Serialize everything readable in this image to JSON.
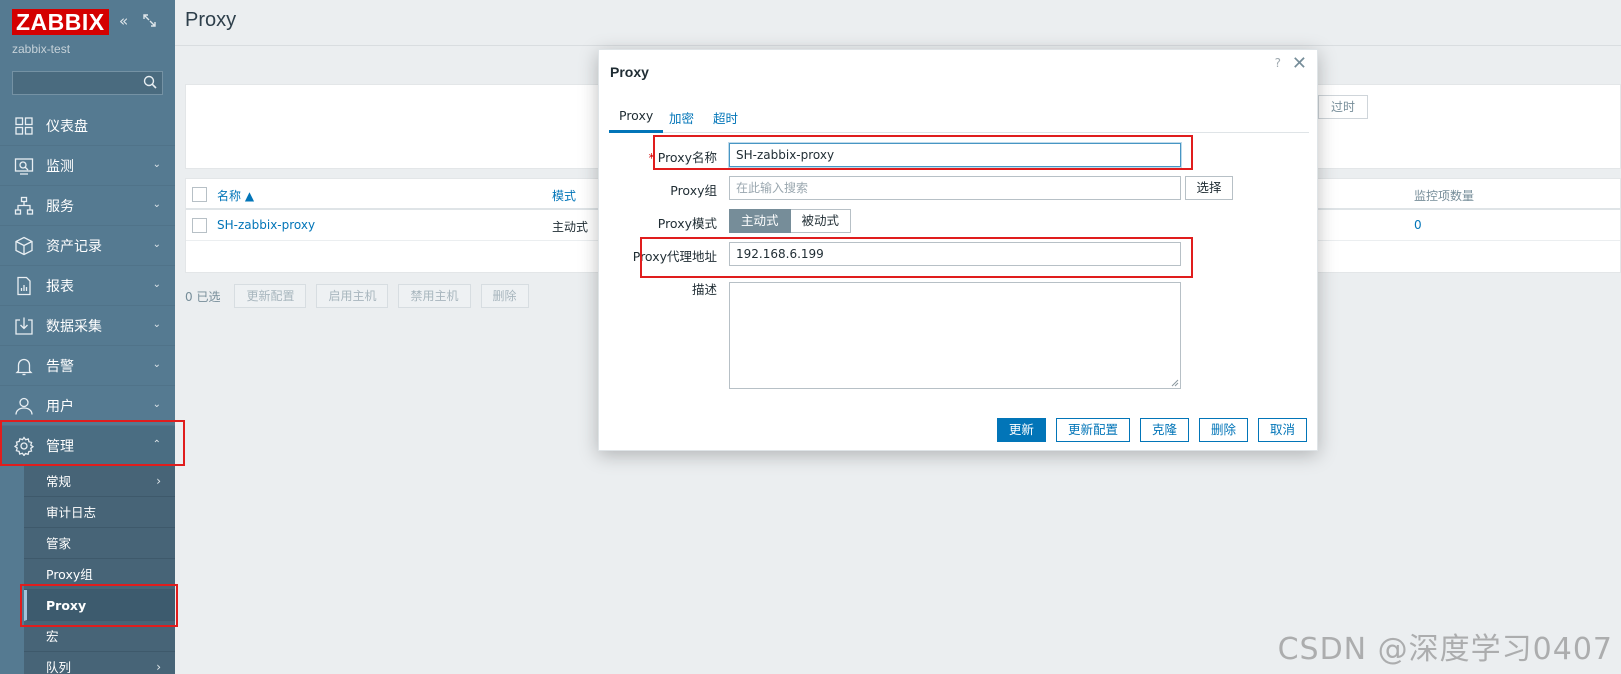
{
  "app": {
    "logo": "ZABBIX",
    "server_name": "zabbix-test"
  },
  "sidebar": {
    "search_placeholder": "",
    "menu": [
      {
        "label": "仪表盘",
        "icon": "dashboard-icon",
        "chevron": ""
      },
      {
        "label": "监测",
        "icon": "monitoring-icon",
        "chevron": "⌄"
      },
      {
        "label": "服务",
        "icon": "services-icon",
        "chevron": "⌄"
      },
      {
        "label": "资产记录",
        "icon": "inventory-icon",
        "chevron": "⌄"
      },
      {
        "label": "报表",
        "icon": "reports-icon",
        "chevron": "⌄"
      },
      {
        "label": "数据采集",
        "icon": "data-collection-icon",
        "chevron": "⌄"
      },
      {
        "label": "告警",
        "icon": "alerts-icon",
        "chevron": "⌄"
      },
      {
        "label": "用户",
        "icon": "users-icon",
        "chevron": "⌄"
      },
      {
        "label": "管理",
        "icon": "administration-icon",
        "chevron": "⌃"
      }
    ],
    "submenu": [
      {
        "label": "常规",
        "chevron": "›"
      },
      {
        "label": "审计日志",
        "chevron": ""
      },
      {
        "label": "管家",
        "chevron": ""
      },
      {
        "label": "Proxy组",
        "chevron": ""
      },
      {
        "label": "Proxy",
        "chevron": ""
      },
      {
        "label": "宏",
        "chevron": ""
      },
      {
        "label": "队列",
        "chevron": "›"
      }
    ]
  },
  "header": {
    "title": "Proxy"
  },
  "filter": {
    "obsolete_label": "过时"
  },
  "table": {
    "columns": {
      "name": "名称 ▲",
      "mode": "模式",
      "items_count": "监控项数量"
    },
    "rows": [
      {
        "name": "SH-zabbix-proxy",
        "mode": "主动式",
        "items_count": "0"
      }
    ]
  },
  "actions": {
    "selected_count": "0 已选",
    "buttons": [
      "更新配置",
      "启用主机",
      "禁用主机",
      "删除"
    ]
  },
  "modal": {
    "title": "Proxy",
    "help": "?",
    "close": "✕",
    "tabs": [
      "Proxy",
      "加密",
      "超时"
    ],
    "fields": {
      "name_required": "*",
      "name_label": "Proxy名称",
      "name_value": "SH-zabbix-proxy",
      "group_label": "Proxy组",
      "group_placeholder": "在此输入搜索",
      "group_select": "选择",
      "mode_label": "Proxy模式",
      "mode_options": [
        "主动式",
        "被动式"
      ],
      "address_label": "Proxy代理地址",
      "address_value": "192.168.6.199",
      "description_label": "描述",
      "description_value": ""
    },
    "buttons": {
      "update": "更新",
      "refresh_config": "更新配置",
      "clone": "克隆",
      "delete": "删除",
      "cancel": "取消"
    }
  },
  "watermark": "CSDN @深度学习0407",
  "colors": {
    "sidebar": "#557a91",
    "brand_red": "#d40000",
    "link_blue": "#0275b8",
    "annotation_red": "#e01d1d"
  }
}
